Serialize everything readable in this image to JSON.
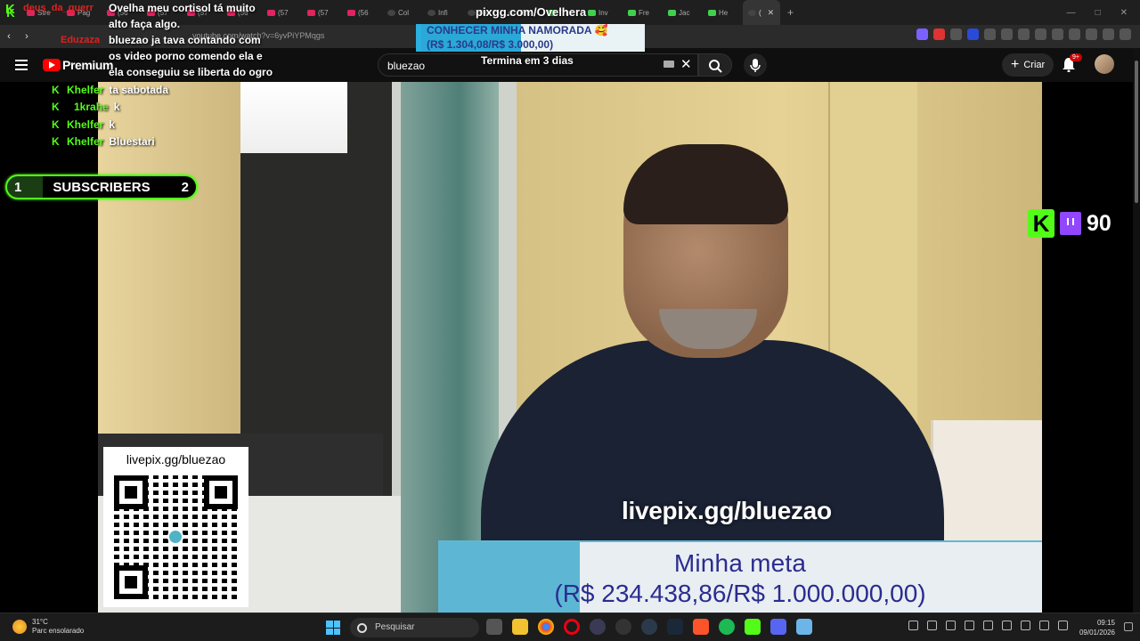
{
  "browser": {
    "tabs": [
      {
        "label": "Stre",
        "fav": "red"
      },
      {
        "label": "Pag",
        "fav": "red"
      },
      {
        "label": "(56",
        "fav": "red"
      },
      {
        "label": "(57",
        "fav": "red"
      },
      {
        "label": "(57",
        "fav": "red"
      },
      {
        "label": "(56",
        "fav": "red"
      },
      {
        "label": "(57",
        "fav": "red"
      },
      {
        "label": "(57",
        "fav": "red"
      },
      {
        "label": "(56",
        "fav": "red"
      },
      {
        "label": "Col",
        "fav": "dark"
      },
      {
        "label": "Infi",
        "fav": "dark"
      },
      {
        "label": "Fre",
        "fav": "dark"
      },
      {
        "label": "The",
        "fav": "dark"
      },
      {
        "label": "The",
        "fav": "green"
      },
      {
        "label": "Inv",
        "fav": "green"
      },
      {
        "label": "Fre",
        "fav": "green"
      },
      {
        "label": "Jac",
        "fav": "green"
      },
      {
        "label": "He",
        "fav": "green"
      },
      {
        "label": "(",
        "fav": "dark",
        "active": true
      }
    ],
    "url": "youtube.com/watch?v=6yvPiYPMqgs"
  },
  "youtube": {
    "brand": "Premium",
    "search_value": "bluezao",
    "create_label": "Criar",
    "notif_badge": "9+"
  },
  "overlay": {
    "chat_red_user_1": "deus_da_guerr",
    "chat_red_user_2": "Eduzaza",
    "chat_top_lines": [
      "Ovelha meu cortisol tá muito",
      "alto faça algo.",
      "bluezao ja tava contando com",
      "os video porno comendo ela e",
      "ela conseguiu se liberta do ogro"
    ],
    "chat_rows": [
      {
        "user": "Khelfer",
        "msg": "ta sabotada"
      },
      {
        "user": "1krahe",
        "msg": "k"
      },
      {
        "user": "Khelfer",
        "msg": "k"
      },
      {
        "user": "Khelfer",
        "msg": "Bluestari"
      }
    ],
    "subs_left": "1",
    "subs_label": "SUBSCRIBERS",
    "subs_right": "2",
    "pix_url": "pixgg.com/Ovelhera",
    "pix_goal_title": "CONHECER MINHA NAMORADA 🥰",
    "pix_goal_amount": "(R$ 1.304,08/R$ 3.000,00)",
    "pix_goal_progress": 0.4347,
    "termina": "Termina em 3 dias",
    "viewer_count": "90"
  },
  "stream": {
    "qr_label": "livepix.gg/bluezao",
    "watermark": "livepix.gg/bluezao",
    "goal_title": "Minha meta",
    "goal_amount": "(R$ 234.438,86/R$ 1.000.000,00)",
    "goal_progress": 0.2344
  },
  "taskbar": {
    "temp": "31°C",
    "weather": "Parc ensolarado",
    "search_placeholder": "Pesquisar",
    "time": "09:15",
    "date": "09/01/2026"
  },
  "colors": {
    "kick_green": "#53fc18",
    "twitch_purple": "#9146ff",
    "youtube_red": "#ff0000",
    "goal_blue": "#5db7d4",
    "goal_text": "#2a2c8f"
  }
}
